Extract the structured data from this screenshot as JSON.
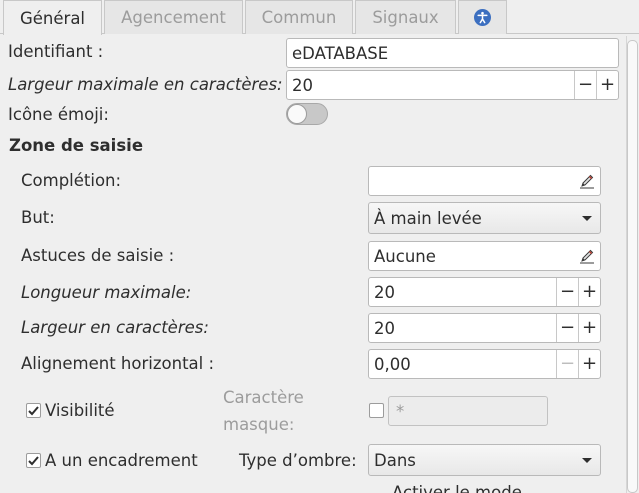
{
  "tabs": [
    {
      "label": "Général"
    },
    {
      "label": "Agencement"
    },
    {
      "label": "Commun"
    },
    {
      "label": "Signaux"
    },
    {
      "label": ""
    }
  ],
  "general": {
    "id_label": "Identifiant :",
    "id_value": "eDATABASE",
    "max_width_label": "Largeur maximale en caractères:",
    "max_width_value": "20",
    "emoji_label": "Icône émoji:",
    "emoji_on": false
  },
  "entry_section": {
    "title": "Zone de saisie",
    "completion_label": "Complétion:",
    "completion_value": "",
    "purpose_label": "But:",
    "purpose_value": "À main levée",
    "hints_label": "Astuces de saisie :",
    "hints_value": "Aucune",
    "max_length_label": "Longueur maximale:",
    "max_length_value": "20",
    "width_chars_label": "Largeur en caractères:",
    "width_chars_value": "20",
    "xalign_label": "Alignement horizontal :",
    "xalign_value": "0,00",
    "visibility_label": "Visibilité",
    "visibility_checked": true,
    "mask_char_label_1": "Caractère",
    "mask_char_label_2": "masque:",
    "mask_char_checked": false,
    "mask_char_value": "*",
    "frame_label": "A un encadrement",
    "frame_checked": true,
    "shadow_label": "Type d’ombre:",
    "shadow_value": "Dans",
    "partial_label": "Activer le mode"
  },
  "spin": {
    "minus": "−",
    "plus": "+"
  },
  "icons": {
    "edit": "pencil-icon",
    "a11y": "accessibility-icon"
  },
  "colors": {
    "accent": "#3c6fc0",
    "bg": "#efefef"
  }
}
